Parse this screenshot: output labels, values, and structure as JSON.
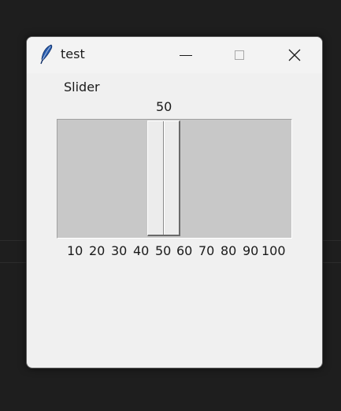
{
  "window": {
    "title": "test",
    "icon": "feather-icon",
    "controls": {
      "minimize": "minimize-icon",
      "maximize": "maximize-icon",
      "close": "close-icon"
    }
  },
  "slider": {
    "label": "Slider",
    "value": 50,
    "value_text": "50",
    "min": 10,
    "max": 100,
    "ticks": [
      "10",
      "20",
      "30",
      "40",
      "50",
      "60",
      "70",
      "80",
      "90",
      "100"
    ]
  },
  "colors": {
    "desktop": "#1e1e1e",
    "window_bg": "#f0f0f0",
    "trough": "#c8c8c8",
    "thumb": "#ececec",
    "feather_accent": "#1f4e9a"
  }
}
